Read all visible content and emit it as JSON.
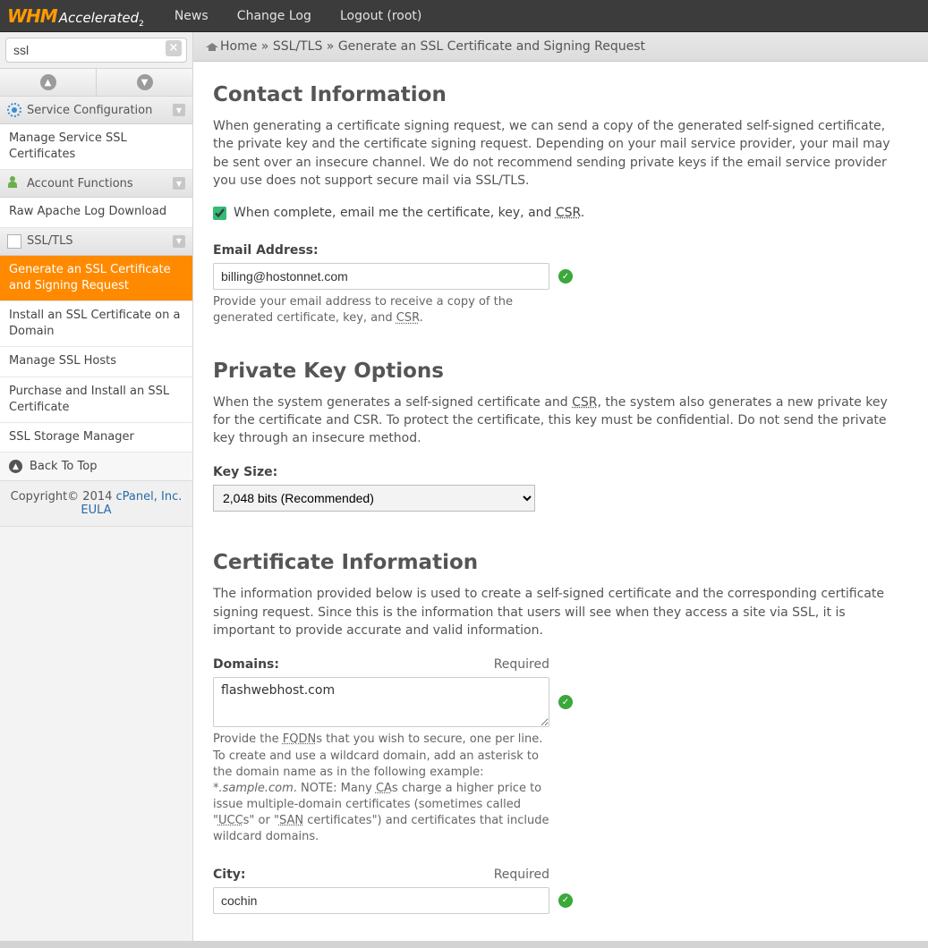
{
  "topnav": {
    "news": "News",
    "changelog": "Change Log",
    "logout": "Logout (root)"
  },
  "logo": {
    "whm": "WHM",
    "acc": "Accelerated",
    "two": "2"
  },
  "search": {
    "value": "ssl"
  },
  "sidebar": {
    "serviceConfig": "Service Configuration",
    "manageServiceSSL": "Manage Service SSL Certificates",
    "accountFunctions": "Account Functions",
    "rawApache": "Raw Apache Log Download",
    "sslTls": "SSL/TLS",
    "genSSL": "Generate an SSL Certificate and Signing Request",
    "installSSL": "Install an SSL Certificate on a Domain",
    "manageHosts": "Manage SSL Hosts",
    "purchaseInstall": "Purchase and Install an SSL Certificate",
    "sslStorage": "SSL Storage Manager",
    "backTop": "Back To Top",
    "copyright": "Copyright© 2014 ",
    "cpanel": "cPanel, Inc.",
    "eula": "EULA"
  },
  "breadcrumb": {
    "home": "Home",
    "ssltls": "SSL/TLS",
    "page": "Generate an SSL Certificate and Signing Request",
    "sep": " » "
  },
  "contact": {
    "heading": "Contact Information",
    "intro": "When generating a certificate signing request, we can send a copy of the generated self-signed certificate, the private key and the certificate signing request. Depending on your mail service provider, your mail may be sent over an insecure channel. We do not recommend sending private keys if the email service provider you use does not support secure mail via SSL/TLS.",
    "checkbox_label_pre": "When complete, email me the certificate, key, and ",
    "checkbox_label_abbr": "CSR",
    "email_label": "Email Address:",
    "email_value": "billing@hostonnet.com",
    "email_help_pre": "Provide your email address to receive a copy of the generated certificate, key, and ",
    "email_help_abbr": "CSR"
  },
  "keyopts": {
    "heading": "Private Key Options",
    "intro_pre": "When the system generates a self-signed certificate and ",
    "intro_abbr": "CSR",
    "intro_post": ", the system also generates a new private key for the certificate and CSR. To protect the certificate, this key must be confidential. Do not send the private key through an insecure method.",
    "keysize_label": "Key Size:",
    "keysize_value": "2,048 bits (Recommended)"
  },
  "certinfo": {
    "heading": "Certificate Information",
    "intro": "The information provided below is used to create a self-signed certificate and the corresponding certificate signing request. Since this is the information that users will see when they access a site via SSL, it is important to provide accurate and valid information.",
    "required": "Required",
    "domains_label": "Domains:",
    "domains_value": "flashwebhost.com",
    "domains_help_1": "Provide the ",
    "domains_help_fqdn": "FQDN",
    "domains_help_2": "s that you wish to secure, one per line. To create and use a wildcard domain, add an asterisk to the domain name as in the following example: ",
    "domains_help_example": "*.sample.com",
    "domains_help_3": ". NOTE: Many ",
    "domains_help_ca": "CA",
    "domains_help_4": "s charge a higher price to issue multiple-domain certificates (sometimes called \"",
    "domains_help_ucc": "UCC",
    "domains_help_5": "s\" or \"",
    "domains_help_san": "SAN",
    "domains_help_6": " certificates\") and certificates that include wildcard domains.",
    "city_label": "City:",
    "city_value": "cochin"
  }
}
